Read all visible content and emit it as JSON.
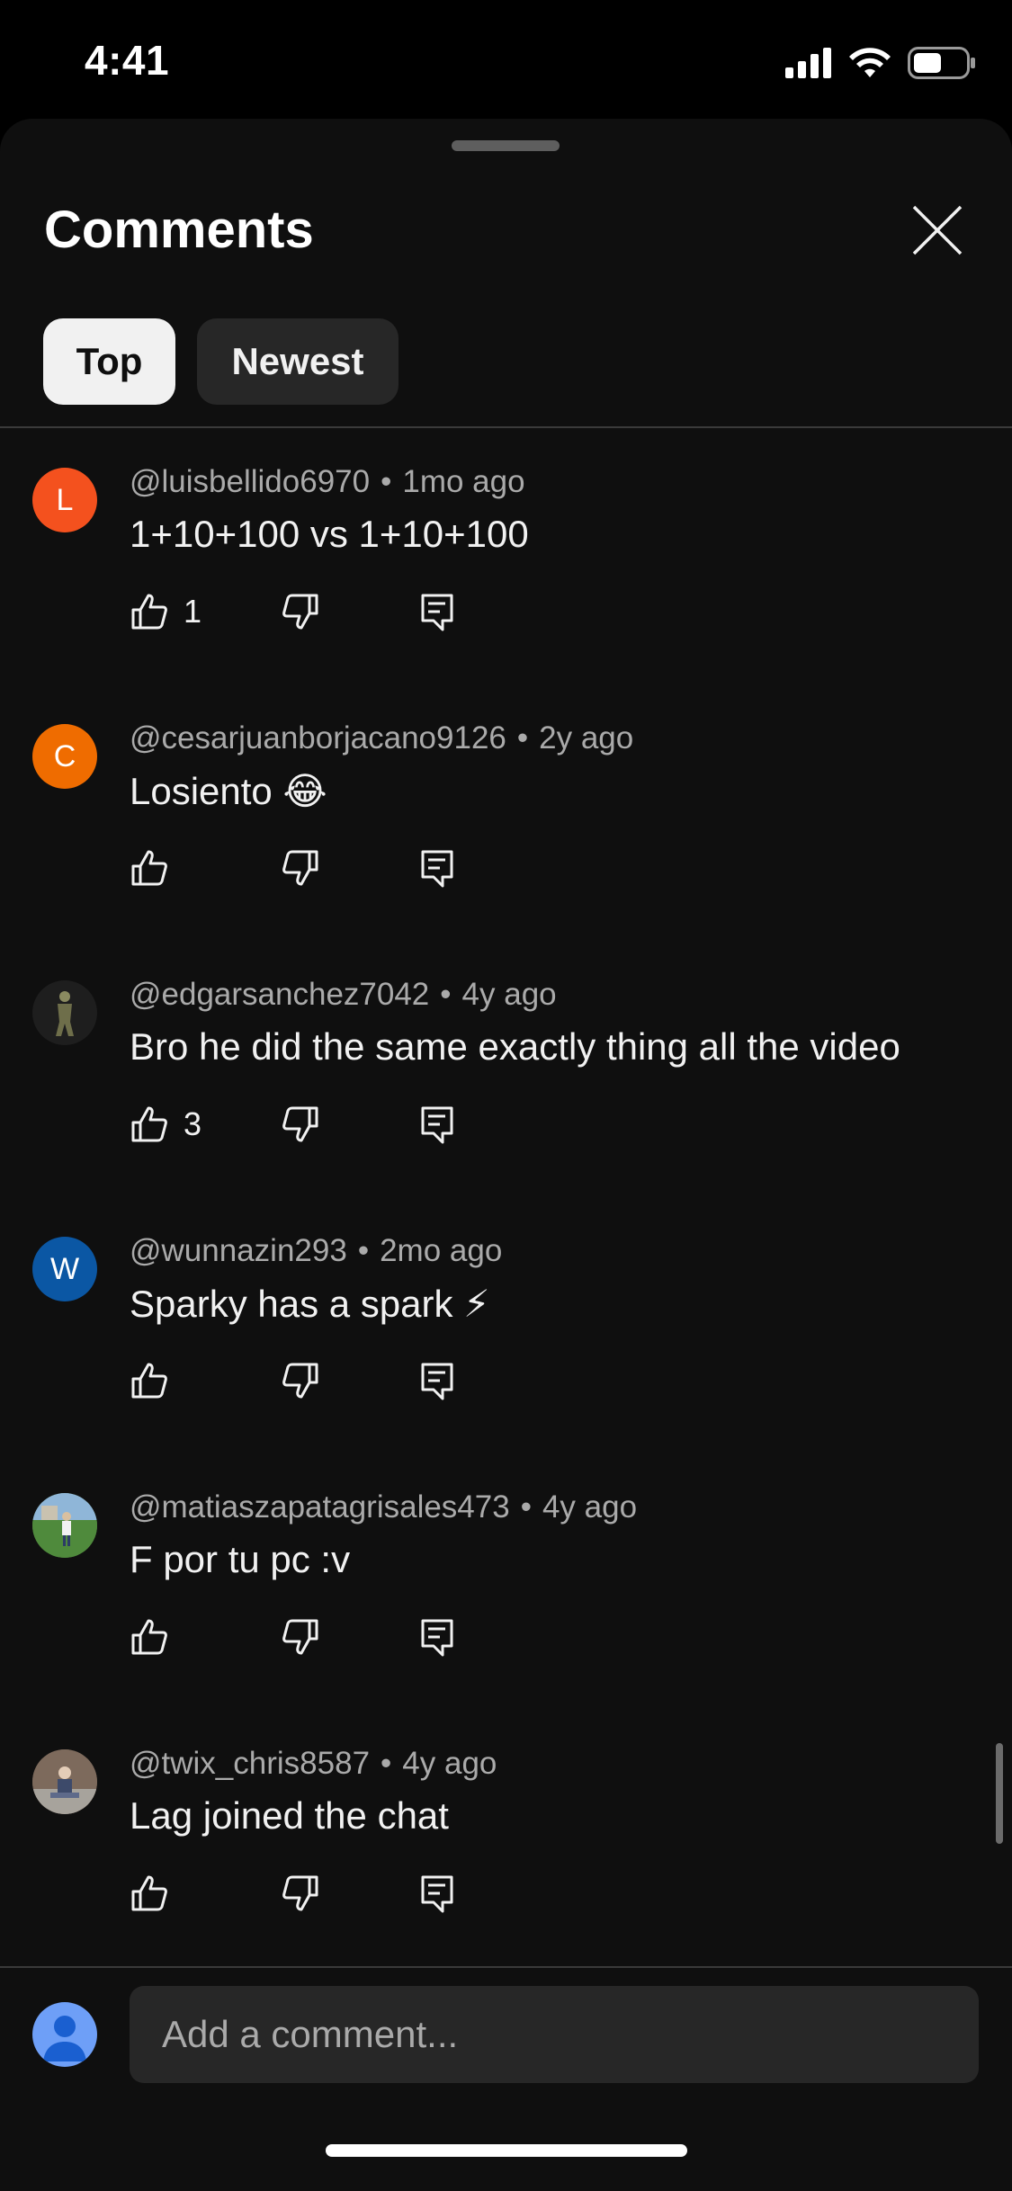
{
  "status_bar": {
    "time": "4:41"
  },
  "sheet": {
    "title": "Comments",
    "close_icon": "close-icon",
    "tabs": [
      {
        "label": "Top",
        "selected": true
      },
      {
        "label": "Newest",
        "selected": false
      }
    ]
  },
  "comments": [
    {
      "author": "@luisbellido6970",
      "age": "1mo ago",
      "text": "1+10+100 vs 1+10+100",
      "likes": "1",
      "avatar_letter": "L",
      "avatar_color": "#f4511e"
    },
    {
      "author": "@cesarjuanborjacano9126",
      "age": "2y ago",
      "text": "Losiento 😂",
      "likes": "",
      "avatar_letter": "C",
      "avatar_color": "#ef6c00"
    },
    {
      "author": "@edgarsanchez7042",
      "age": "4y ago",
      "text": "Bro he did the same exactly thing all the video",
      "likes": "3",
      "avatar_letter": "",
      "avatar_color": "#1e1e1e"
    },
    {
      "author": "@wunnazin293",
      "age": "2mo ago",
      "text": "Sparky has a spark ⚡",
      "likes": "",
      "avatar_letter": "W",
      "avatar_color": "#0b57a4"
    },
    {
      "author": "@matiaszapatagrisales473",
      "age": "4y ago",
      "text": "F por tu pc :v",
      "likes": "",
      "avatar_letter": "",
      "avatar_color": "#4a7a3a"
    },
    {
      "author": "@twix_chris8587",
      "age": "4y ago",
      "text": "Lag joined the chat",
      "likes": "",
      "avatar_letter": "",
      "avatar_color": "#5a4c42"
    }
  ],
  "composer": {
    "placeholder": "Add a comment..."
  },
  "colors": {
    "background": "#0f0f0f",
    "chip_selected": "#f1f1f1",
    "chip_unselected": "#272727",
    "secondary_text": "#aaaaaa"
  }
}
